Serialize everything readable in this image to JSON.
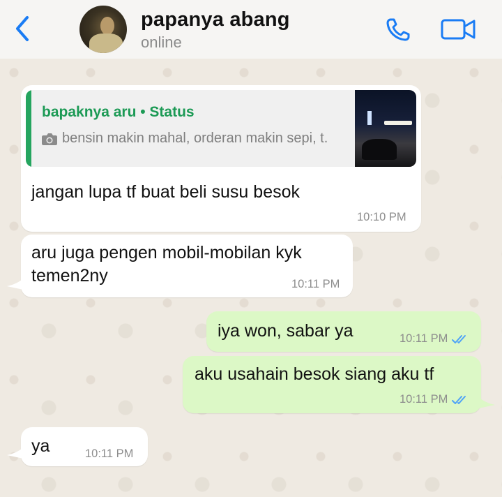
{
  "header": {
    "contact_name": "papanya abang",
    "contact_status": "online",
    "icons": [
      "chevron-left-icon",
      "phone-icon",
      "video-camera-icon"
    ],
    "accent_color": "#1a7cf4"
  },
  "messages": [
    {
      "direction": "incoming",
      "quote": {
        "author": "bapaknya aru • Status",
        "text": "bensin makin mahal, orderan makin sepi, t.",
        "icon": "camera-icon"
      },
      "text": "jangan lupa tf buat beli susu besok",
      "time": "10:10 PM"
    },
    {
      "direction": "incoming",
      "text": "aru juga pengen mobil-mobilan kyk\ntemen2ny",
      "time": "10:11 PM"
    },
    {
      "direction": "outgoing",
      "text": "iya won, sabar ya",
      "time": "10:11 PM",
      "read": true
    },
    {
      "direction": "outgoing",
      "text": "aku usahain besok siang aku tf",
      "time": "10:11 PM",
      "read": true
    },
    {
      "direction": "incoming",
      "text": "ya",
      "time": "10:11 PM"
    }
  ],
  "colors": {
    "incoming_bubble": "#ffffff",
    "outgoing_bubble": "#dcf8c6",
    "status_green": "#25a55f",
    "read_ticks": "#4fa3f7"
  }
}
